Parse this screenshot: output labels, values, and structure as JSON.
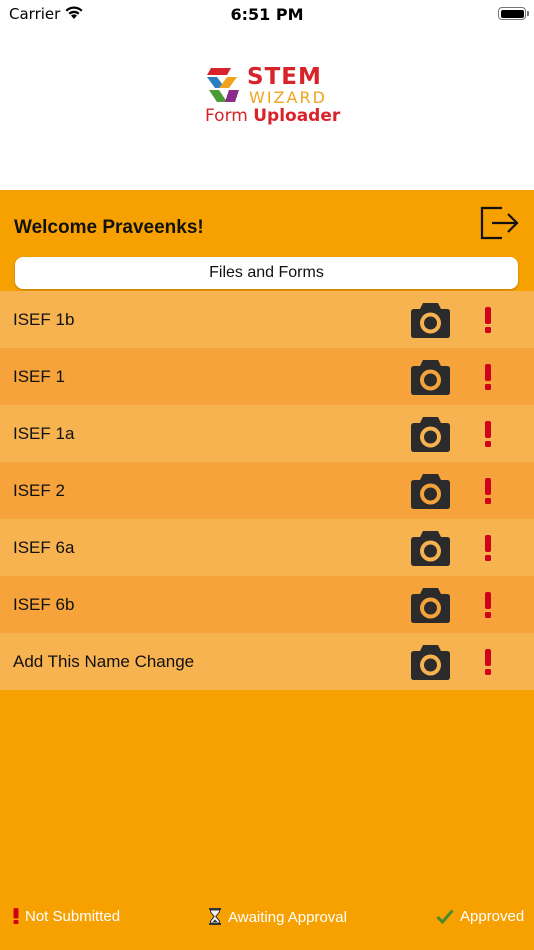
{
  "status_bar": {
    "carrier": "Carrier",
    "time": "6:51 PM"
  },
  "logo": {
    "line1": "STEM",
    "line2": "WIZARD",
    "line3_a": "Form",
    "line3_b": "Uploader"
  },
  "header": {
    "welcome": "Welcome Praveenks!",
    "logout_icon": "logout-icon"
  },
  "files_button": {
    "label": "Files and Forms"
  },
  "forms": [
    {
      "label": "ISEF 1b",
      "status": "not-submitted"
    },
    {
      "label": "ISEF 1",
      "status": "not-submitted"
    },
    {
      "label": "ISEF 1a",
      "status": "not-submitted"
    },
    {
      "label": "ISEF 2",
      "status": "not-submitted"
    },
    {
      "label": "ISEF 6a",
      "status": "not-submitted"
    },
    {
      "label": "ISEF 6b",
      "status": "not-submitted"
    },
    {
      "label": "Add This Name Change",
      "status": "not-submitted"
    }
  ],
  "legend": {
    "not_submitted": "Not Submitted",
    "awaiting": "Awaiting Approval",
    "approved": "Approved"
  },
  "colors": {
    "background": "#f7a101",
    "row_light": "#f8b351",
    "row_dark": "#f6a33b",
    "status_red": "#d0021b",
    "approved_green": "#4b8a2a"
  }
}
